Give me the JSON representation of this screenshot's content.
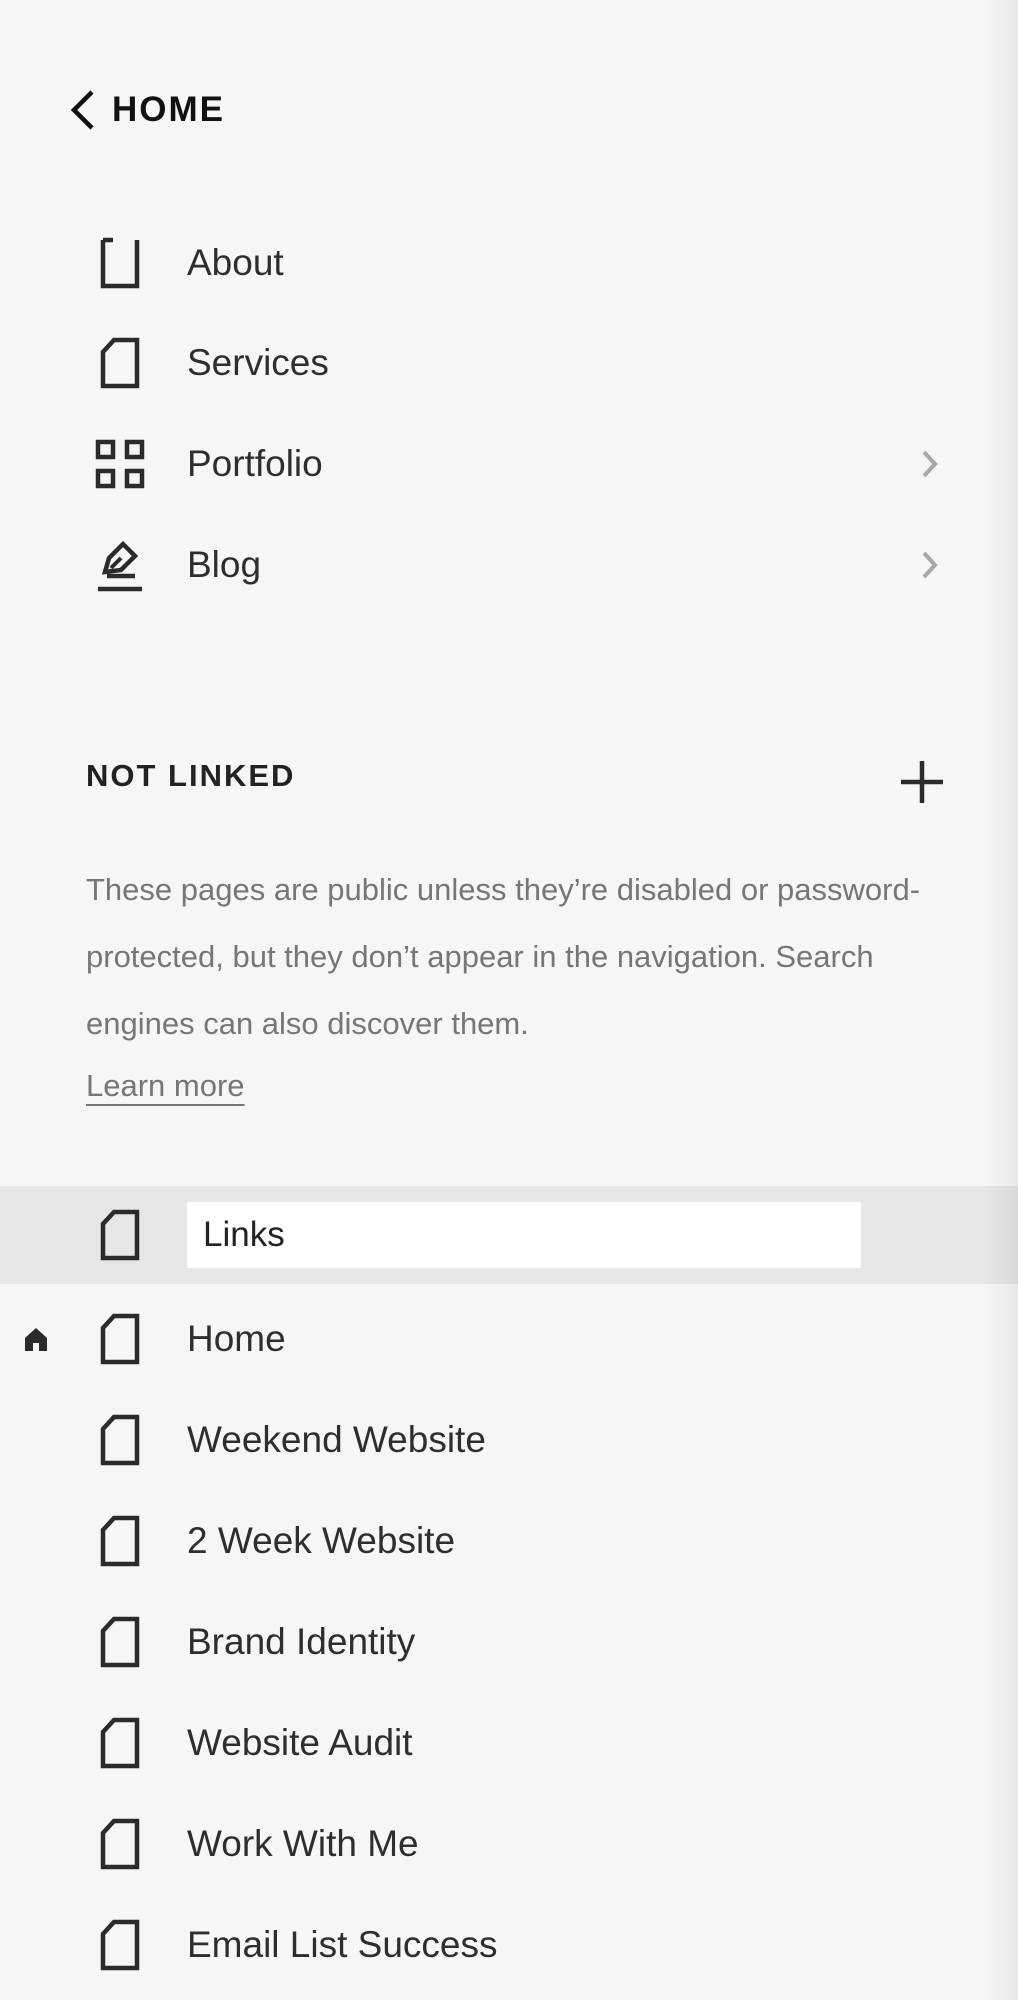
{
  "header": {
    "back_label": "HOME",
    "back_icon": "chevron-left-icon"
  },
  "main_nav": {
    "items": [
      {
        "label": "About",
        "icon": "page-icon",
        "has_children": false
      },
      {
        "label": "Services",
        "icon": "page-icon",
        "has_children": false
      },
      {
        "label": "Portfolio",
        "icon": "grid-icon",
        "has_children": true
      },
      {
        "label": "Blog",
        "icon": "blog-pen-icon",
        "has_children": true
      }
    ]
  },
  "not_linked": {
    "heading": "NOT LINKED",
    "add_icon": "plus-icon",
    "description": "These pages are public unless they’re disabled or password-protected, but they don’t appear in the navigation. Search engines can also discover them.",
    "learn_more": "Learn more",
    "editing_page": {
      "value": "Links",
      "icon": "page-icon"
    },
    "items": [
      {
        "label": "Home",
        "icon": "page-icon",
        "is_homepage": true
      },
      {
        "label": "Weekend Website",
        "icon": "page-icon"
      },
      {
        "label": "2 Week Website",
        "icon": "page-icon"
      },
      {
        "label": "Brand Identity",
        "icon": "page-icon"
      },
      {
        "label": "Website Audit",
        "icon": "page-icon"
      },
      {
        "label": "Work With Me",
        "icon": "page-icon"
      },
      {
        "label": "Email List Success",
        "icon": "page-icon"
      }
    ]
  },
  "colors": {
    "background": "#f6f6f6",
    "editing_row": "#e6e6e6",
    "text": "#2e2e2e",
    "muted_text": "#767676",
    "chevron": "#a8a8a8"
  }
}
